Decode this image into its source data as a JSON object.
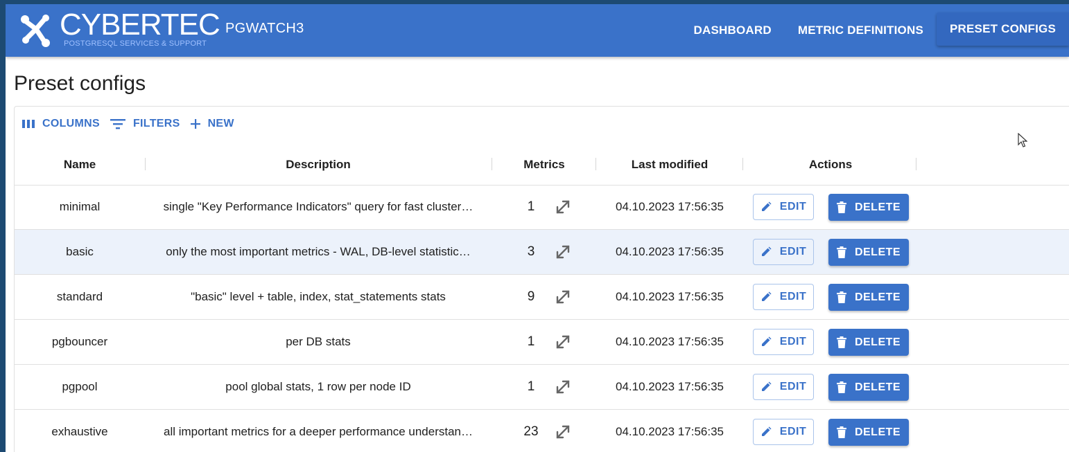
{
  "brand": {
    "logo_text": "CYBERTEC",
    "logo_tagline": "POSTGRESQL SERVICES & SUPPORT",
    "app_name": "PGWATCH3"
  },
  "nav": {
    "items": [
      {
        "label": "DASHBOARD",
        "active": false
      },
      {
        "label": "METRIC DEFINITIONS",
        "active": false
      },
      {
        "label": "PRESET CONFIGS",
        "active": true
      }
    ]
  },
  "page": {
    "title": "Preset configs"
  },
  "toolbar": {
    "columns_label": "COLUMNS",
    "filters_label": "FILTERS",
    "new_label": "NEW"
  },
  "table": {
    "headers": {
      "name": "Name",
      "description": "Description",
      "metrics": "Metrics",
      "last_modified": "Last modified",
      "actions": "Actions"
    },
    "edit_label": "EDIT",
    "delete_label": "DELETE",
    "rows": [
      {
        "name": "minimal",
        "description": "single \"Key Performance Indicators\" query for fast cluster…",
        "metrics": "1",
        "last_modified": "04.10.2023 17:56:35"
      },
      {
        "name": "basic",
        "description": "only the most important metrics - WAL, DB-level statistic…",
        "metrics": "3",
        "last_modified": "04.10.2023 17:56:35"
      },
      {
        "name": "standard",
        "description": "\"basic\" level + table, index, stat_statements stats",
        "metrics": "9",
        "last_modified": "04.10.2023 17:56:35"
      },
      {
        "name": "pgbouncer",
        "description": "per DB stats",
        "metrics": "1",
        "last_modified": "04.10.2023 17:56:35"
      },
      {
        "name": "pgpool",
        "description": "pool global stats, 1 row per node ID",
        "metrics": "1",
        "last_modified": "04.10.2023 17:56:35"
      },
      {
        "name": "exhaustive",
        "description": "all important metrics for a deeper performance understan…",
        "metrics": "23",
        "last_modified": "04.10.2023 17:56:35"
      }
    ]
  },
  "colors": {
    "appbar": "#3a72c9",
    "accent": "#3a72c9",
    "row_highlight": "#ecf2fb",
    "page_background": "#1d4a72"
  },
  "icons": [
    "columns-icon",
    "filter-icon",
    "plus-icon",
    "expand-icon",
    "pencil-icon",
    "trash-icon",
    "mouse-cursor-icon"
  ]
}
